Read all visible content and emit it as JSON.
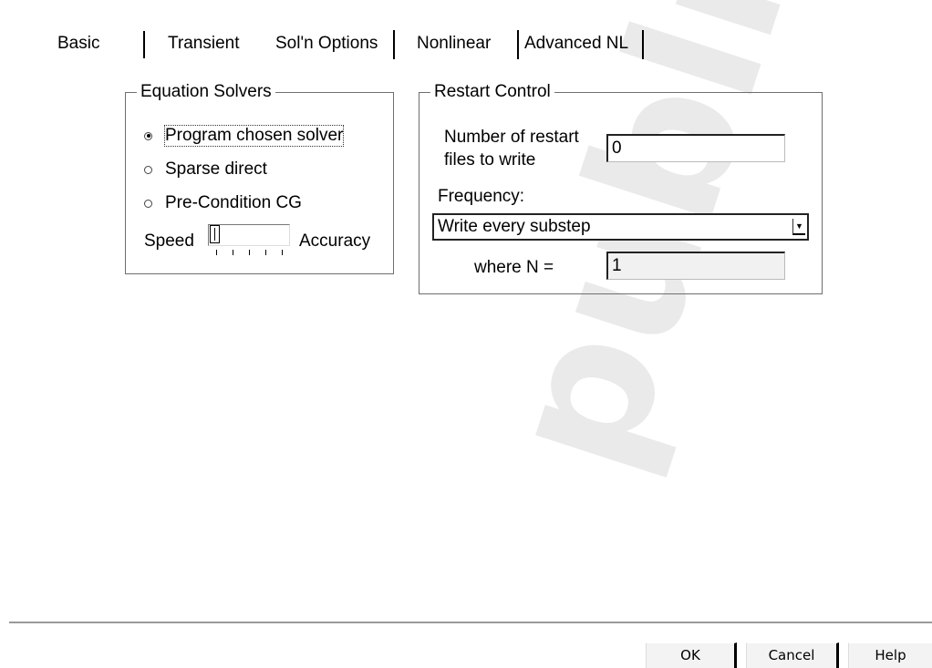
{
  "tabs": [
    {
      "label": "Basic"
    },
    {
      "label": "Transient"
    },
    {
      "label": "Sol'n Options",
      "selected": true
    },
    {
      "label": "Nonlinear"
    },
    {
      "label": "Advanced NL"
    }
  ],
  "equation_solvers": {
    "title": "Equation Solvers",
    "options": [
      {
        "label": "Program chosen solver",
        "checked": true
      },
      {
        "label": "Sparse direct",
        "checked": false
      },
      {
        "label": "Pre-Condition CG",
        "checked": false
      }
    ],
    "speed_label": "Speed",
    "accuracy_label": "Accuracy"
  },
  "restart_control": {
    "title": "Restart Control",
    "num_files_label_line1": "Number of restart",
    "num_files_label_line2": "files to write",
    "num_files_value": "0",
    "frequency_label": "Frequency:",
    "frequency_value": "Write every substep",
    "where_n_label": "where N =",
    "where_n_value": "1"
  },
  "buttons": {
    "ok": "OK",
    "cancel": "Cancel",
    "help": "Help"
  },
  "watermark_text": "publisher"
}
